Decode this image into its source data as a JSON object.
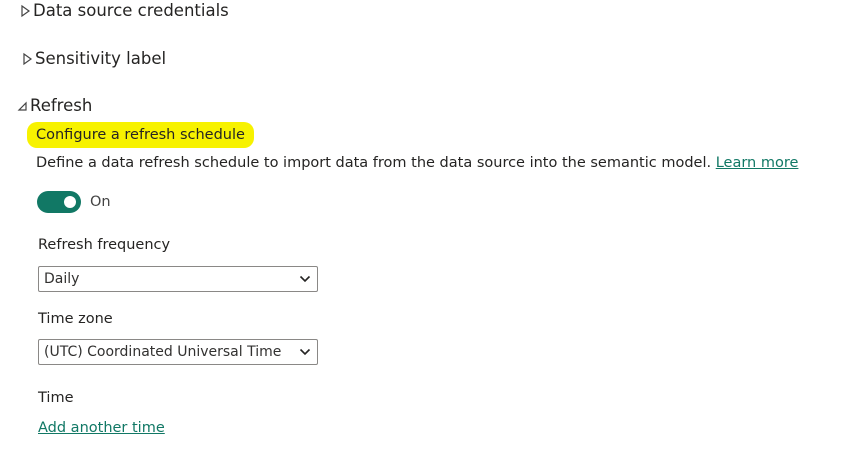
{
  "sections": {
    "credentials": {
      "label": "Data source credentials",
      "icon": "caret-right-icon"
    },
    "sensitivity": {
      "label": "Sensitivity label",
      "icon": "caret-right-icon"
    },
    "refresh": {
      "label": "Refresh",
      "icon": "caret-down-icon"
    }
  },
  "refresh": {
    "title": "Configure a refresh schedule",
    "description": "Define a data refresh schedule to import data from the data source into the semantic model.",
    "learn_more": "Learn more",
    "toggle": {
      "state": "On",
      "enabled": true
    },
    "frequency": {
      "label": "Refresh frequency",
      "value": "Daily"
    },
    "timezone": {
      "label": "Time zone",
      "value": "(UTC) Coordinated Universal Time"
    },
    "time": {
      "label": "Time",
      "add_link": "Add another time"
    }
  },
  "colors": {
    "accent": "#117865",
    "highlight": "#f7f200",
    "text": "#252423"
  }
}
